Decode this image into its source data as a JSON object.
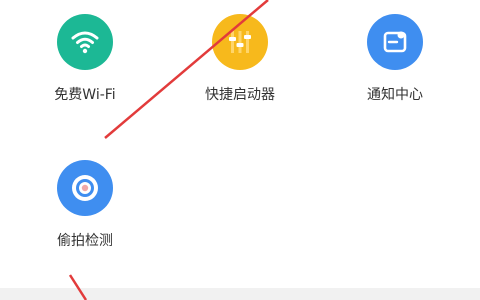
{
  "tools": [
    {
      "label": "免费Wi-Fi",
      "icon": "wifi-icon",
      "color": "#1cb895"
    },
    {
      "label": "快捷启动器",
      "icon": "launcher-sliders-icon",
      "color": "#f7b91c"
    },
    {
      "label": "通知中心",
      "icon": "notification-card-icon",
      "color": "#3f8ef0"
    },
    {
      "label": "偷拍检测",
      "icon": "camera-lens-icon",
      "color": "#3f8ef0"
    }
  ],
  "annotation_color": "#e23b3b"
}
